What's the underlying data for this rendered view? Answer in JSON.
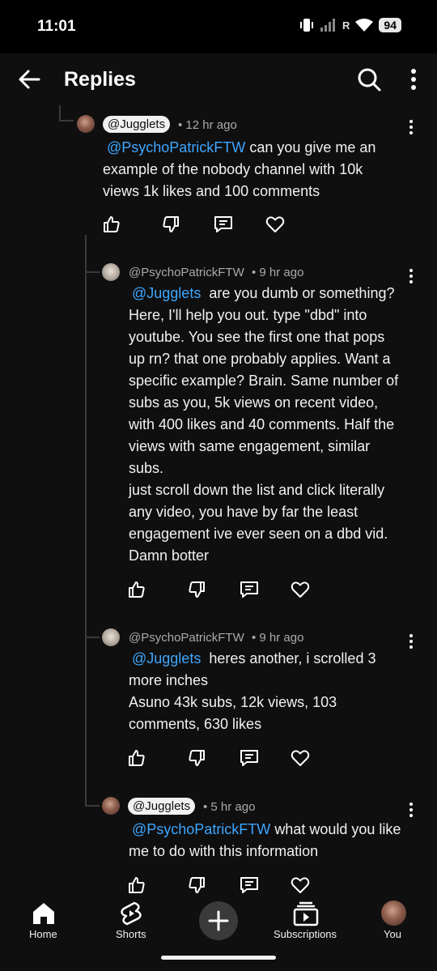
{
  "status_bar": {
    "time": "11:01",
    "network": "R",
    "battery": "94"
  },
  "header": {
    "title": "Replies"
  },
  "comments": [
    {
      "author": "@Jugglets",
      "meta": "• 12 hr ago",
      "mention": "@PsychoPatrickFTW",
      "lines": [
        "can you give me an",
        "example of the nobody channel with 10k",
        "views 1k likes and 100 comments"
      ]
    },
    {
      "author": "@PsychoPatrickFTW",
      "meta": "• 9 hr ago",
      "mention": "@Jugglets",
      "lines": [
        "are you dumb or something?",
        "Here, I'll help you out. type \"dbd\" into",
        "youtube. You see the first one that pops",
        "up rn? that one probably applies. Want a",
        "specific example? Brain. Same number of",
        "subs as you,  5k views on recent video,",
        "with 400 likes and 40 comments. Half the",
        "views with same engagement, similar",
        "subs.",
        "just scroll down the list and click literally",
        "any video, you have by far the least",
        "engagement ive ever seen on a dbd vid.",
        "Damn botter"
      ]
    },
    {
      "author": "@PsychoPatrickFTW",
      "meta": "• 9 hr ago",
      "mention": "@Jugglets",
      "lines": [
        "heres another, i scrolled 3",
        "more inches",
        "Asuno 43k subs, 12k views,  103",
        "comments, 630 likes"
      ]
    },
    {
      "author": "@Jugglets",
      "meta": "• 5 hr ago",
      "mention": "@PsychoPatrickFTW",
      "lines": [
        "what would you like",
        "me to do with this information"
      ]
    }
  ],
  "bottom_nav": {
    "home": "Home",
    "shorts": "Shorts",
    "subscriptions": "Subscriptions",
    "you": "You"
  }
}
